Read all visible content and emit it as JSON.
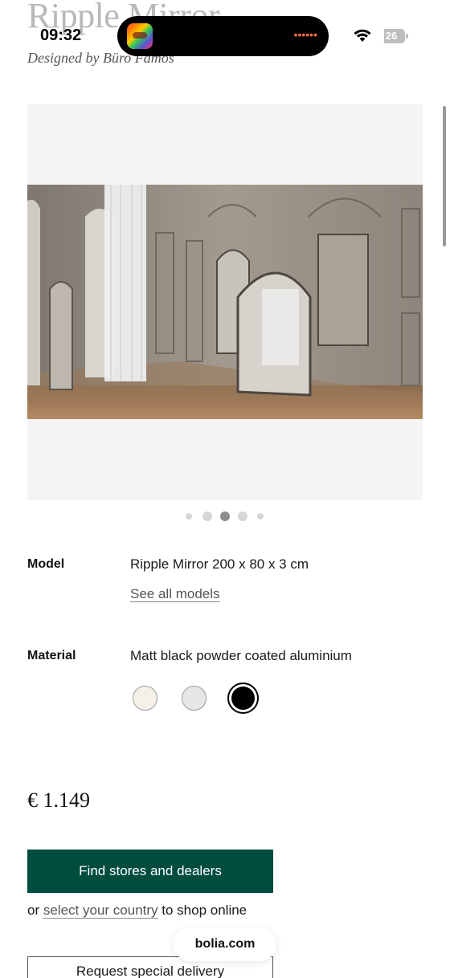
{
  "status_bar": {
    "time": "09:32",
    "battery": "26",
    "recording_indicator": "••••••"
  },
  "product": {
    "title": "Ripple Mirror",
    "designer": "Designed by Büro Famos"
  },
  "gallery": {
    "image_label": "Ripple mirrors in a paneled room",
    "page_count": 5,
    "active_page": 3
  },
  "details": {
    "model_label": "Model",
    "model_value": "Ripple Mirror 200 x 80 x 3 cm",
    "see_all_models": "See all models",
    "material_label": "Material",
    "material_value": "Matt black powder coated aluminium",
    "swatches": [
      {
        "name": "off-white",
        "color": "#f5f1e8",
        "selected": false
      },
      {
        "name": "light-grey",
        "color": "#e6e6e6",
        "selected": false
      },
      {
        "name": "matt-black",
        "color": "#000000",
        "selected": true
      }
    ]
  },
  "price": "€ 1.149",
  "actions": {
    "find_stores": "Find stores and dealers",
    "shop_prefix": "or",
    "select_country": "select your country",
    "shop_suffix": "to shop online",
    "request_delivery": "Request special delivery"
  },
  "browser": {
    "url": "bolia.com"
  },
  "colors": {
    "accent": "#004d40",
    "muted_title": "#b9b9b9",
    "gallery_bg": "#f4f4f4",
    "recording": "#ff6b3d"
  }
}
